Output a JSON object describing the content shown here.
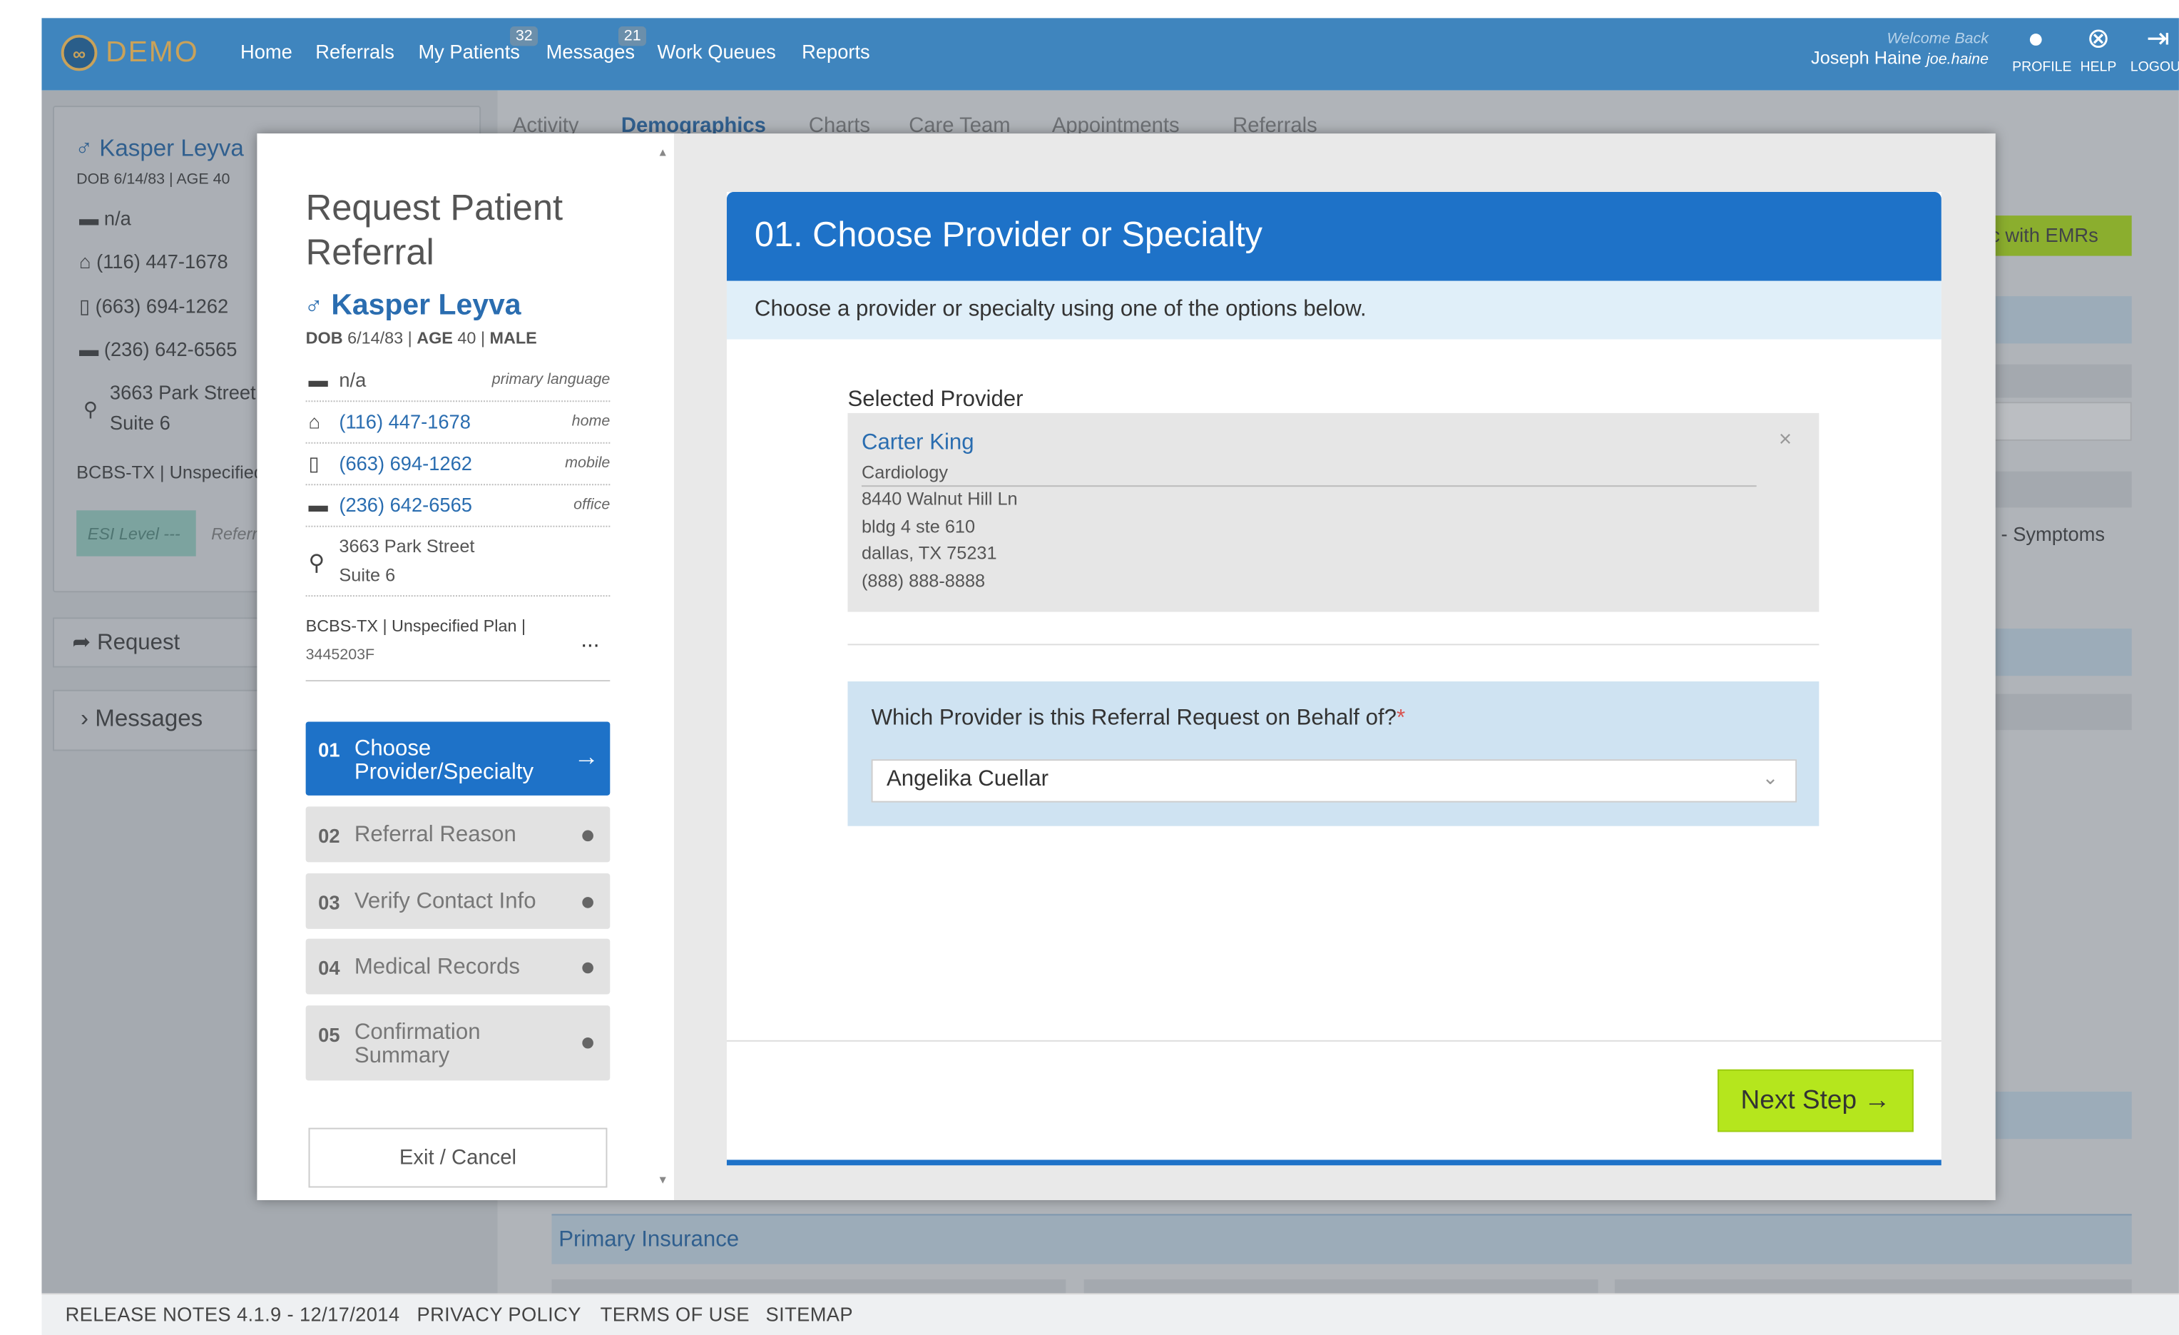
{
  "header": {
    "logo_text": "DEMO",
    "logo_glyph": "∞",
    "nav": {
      "home": "Home",
      "referrals": "Referrals",
      "my_patients": "My Patients",
      "my_patients_badge": "32",
      "messages": "Messages",
      "messages_badge": "21",
      "work_queues": "Work Queues",
      "reports": "Reports"
    },
    "welcome": "Welcome Back",
    "user_name": "Joseph Haine",
    "user_handle": "joe.haine",
    "profile": "PROFILE",
    "help": "HELP",
    "logout": "LOGOUT"
  },
  "background": {
    "patient_name": "Kasper Leyva",
    "dob_line": "DOB 6/14/83 | AGE 40",
    "language": "n/a",
    "home_phone": "(116) 447-1678",
    "mobile_phone": "(663) 694-1262",
    "office_phone": "(236) 642-6565",
    "street": "3663 Park Street",
    "suite": "Suite 6",
    "insurance": "BCBS-TX | Unspecified",
    "esi": "ESI Level ---",
    "referral": "Referral",
    "request": "Request",
    "messages": "Messages",
    "tabs": [
      "Activity",
      "Demographics",
      "Charts",
      "Care Team",
      "Appointments",
      "Referrals"
    ],
    "sync_button": "Sync with EMRs",
    "symptoms": "- Symptoms",
    "primary_insurance": "Primary Insurance"
  },
  "footer": {
    "release_notes": "RELEASE NOTES 4.1.9 - 12/17/2014",
    "privacy": "PRIVACY POLICY",
    "terms": "TERMS OF USE",
    "sitemap": "SITEMAP"
  },
  "modal": {
    "title": "Request Patient Referral",
    "patient": {
      "gender_symbol": "♂",
      "name": "Kasper Leyva",
      "dob_label": "DOB",
      "dob": "6/14/83",
      "age_label": "AGE",
      "age": "40",
      "sex": "MALE",
      "language": "n/a",
      "language_label": "primary language",
      "home_phone": "(116) 447-1678",
      "home_label": "home",
      "mobile_phone": "(663) 694-1262",
      "mobile_label": "mobile",
      "office_phone": "(236) 642-6565",
      "office_label": "office",
      "street": "3663 Park Street",
      "suite": "Suite 6",
      "insurance_line1": "BCBS-TX | Unspecified Plan |",
      "insurance_line2": "3445203F",
      "insurance_more": "..."
    },
    "steps": [
      {
        "num": "01",
        "label": "Choose Provider/Specialty",
        "active": true
      },
      {
        "num": "02",
        "label": "Referral Reason"
      },
      {
        "num": "03",
        "label": "Verify Contact Info"
      },
      {
        "num": "04",
        "label": "Medical Records"
      },
      {
        "num": "05",
        "label": "Confirmation Summary"
      }
    ],
    "active_arrow": "→",
    "exit": "Exit / Cancel",
    "panel": {
      "heading": "01. Choose Provider or Specialty",
      "description": "Choose a provider or specialty using one of the options below.",
      "selected_label": "Selected Provider",
      "provider": {
        "name": "Carter King",
        "specialty": "Cardiology",
        "address1": "8440 Walnut Hill Ln",
        "address2": "bldg 4 ste 610",
        "city": "dallas, TX 75231",
        "phone": "(888) 888-8888",
        "close": "×"
      },
      "behalf_label": "Which Provider is this Referral Request on Behalf of?",
      "required_mark": "*",
      "behalf_value": "Angelika Cuellar",
      "next_button": "Next Step →"
    }
  },
  "colors": {
    "header_bg": "#3f85be",
    "primary_blue": "#1e72c8",
    "link_blue": "#2a6db0",
    "next_green": "#b5e61d"
  }
}
